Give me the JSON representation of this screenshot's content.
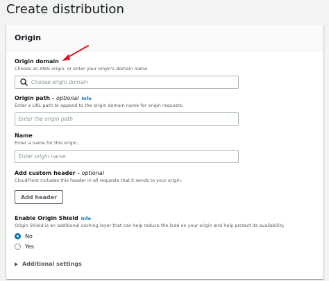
{
  "page_title": "Create distribution",
  "section": {
    "title": "Origin"
  },
  "origin_domain": {
    "label": "Origin domain",
    "description": "Choose an AWS origin, or enter your origin's domain name.",
    "placeholder": "Choose origin domain",
    "icon": "search-icon"
  },
  "origin_path": {
    "label": "Origin path - ",
    "label_optional": "optional",
    "info": "Info",
    "description": "Enter a URL path to append to the origin domain name for origin requests.",
    "placeholder": "Enter the origin path"
  },
  "name": {
    "label": "Name",
    "description": "Enter a name for this origin.",
    "placeholder": "Enter origin name"
  },
  "custom_header": {
    "label": "Add custom header - ",
    "label_optional": "optional",
    "description": "CloudFront includes this header in all requests that it sends to your origin.",
    "button": "Add header"
  },
  "origin_shield": {
    "label": "Enable Origin Shield",
    "info": "Info",
    "description": "Origin Shield is an additional caching layer that can help reduce the load on your origin and help protect its availability.",
    "options": [
      "No",
      "Yes"
    ],
    "selected": "No"
  },
  "additional_settings": {
    "label": "Additional settings"
  },
  "colors": {
    "accent": "#0073bb",
    "annotation": "#e8111a",
    "background": "#f2f3f3"
  }
}
